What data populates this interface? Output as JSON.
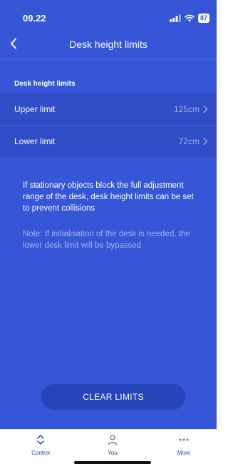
{
  "status_bar": {
    "time": "09.22",
    "battery": "87"
  },
  "nav": {
    "title": "Desk height limits"
  },
  "section": {
    "header": "Desk height limits"
  },
  "rows": [
    {
      "label": "Upper limit",
      "value": "125cm"
    },
    {
      "label": "Lower limit",
      "value": "72cm"
    }
  ],
  "info": {
    "description": "If stationary objects block the full adjustment range of the desk, desk height limits can be set to prevent collisions",
    "note": "Note: If initialisation of the desk is needed, the lower desk limit will be bypassed"
  },
  "actions": {
    "clear_label": "CLEAR LIMITS"
  },
  "tabs": [
    {
      "label": "Control",
      "icon": "chevrons-up-down-icon"
    },
    {
      "label": "You",
      "icon": "person-icon"
    },
    {
      "label": "More",
      "icon": "more-dots-icon"
    }
  ],
  "colors": {
    "background": "#3556d6",
    "row": "#2f4dc7",
    "button": "#2645b8",
    "tab_active": "#2645b8"
  }
}
